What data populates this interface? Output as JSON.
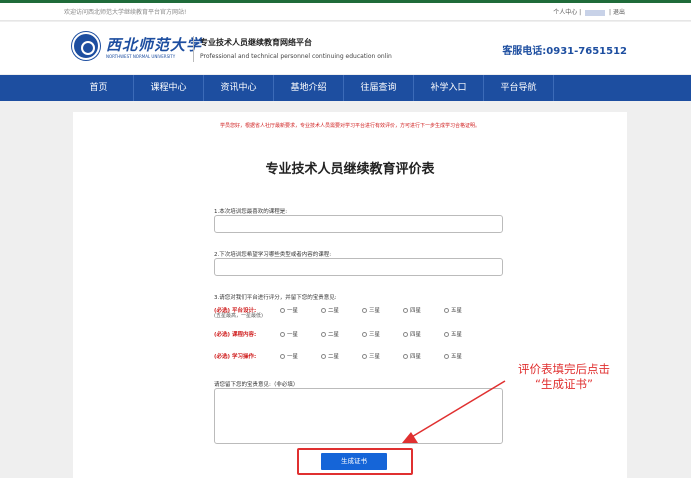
{
  "topbar": {
    "welcome": "欢迎访问西北师范大学继续教育平台官方网站!",
    "personal_center": "个人中心",
    "separator": "|",
    "logout": "退出"
  },
  "header": {
    "logo_cn": "西北师范大学",
    "logo_en": "NORTHWEST NORMAL UNIVERSITY",
    "title": "专业技术人员继续教育网络平台",
    "subtitle": "Professional and technical personnel continuing education onlin",
    "hotline": "客服电话:0931-7651512"
  },
  "nav": {
    "items": [
      "首页",
      "课程中心",
      "资讯中心",
      "基地介绍",
      "往届查询",
      "补学入口",
      "平台导航"
    ]
  },
  "form": {
    "notice": "学员您好，根据省人社厅最新要求，专业技术人员需要对学习平台进行有效评价，方可进行下一步生成学习合格证明。",
    "title": "专业技术人员继续教育评价表",
    "q1": "1.本次培训您最喜欢的课程是:",
    "q2": "2.下次培训您希望学习哪些类型或者内容的课程:",
    "q3": "3.请您对我们平台进行评分，并留下您的宝贵意见:",
    "ratings": [
      {
        "label": "(必选) 平台设计:",
        "note": "(五星最高，一星最低)"
      },
      {
        "label": "(必选) 课程内容:",
        "note": ""
      },
      {
        "label": "(必选) 学习操作:",
        "note": ""
      }
    ],
    "options": [
      "一星",
      "二星",
      "三星",
      "四星",
      "五星"
    ],
    "comment_label": "请您留下您的宝贵意见:（非必填）",
    "generate_button": "生成证书"
  },
  "annotation": {
    "line1": "评价表填完后点击",
    "line2": "“生成证书”",
    "color": "#e03030"
  }
}
